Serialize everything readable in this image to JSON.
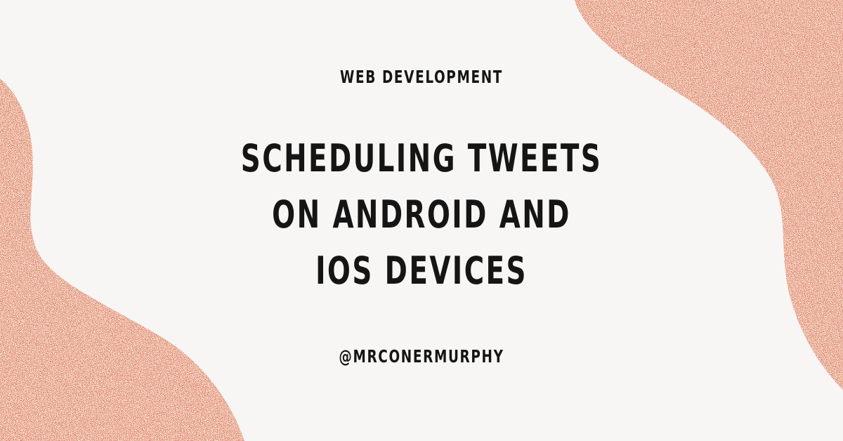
{
  "category": "WEB DEVELOPMENT",
  "title_lines": [
    "SCHEDULING TWEETS",
    "ON ANDROID AND",
    "IOS DEVICES"
  ],
  "handle": "@MRCONERMURPHY",
  "colors": {
    "background": "#f7f6f4",
    "accent": "#d0613f",
    "text": "#151515"
  }
}
